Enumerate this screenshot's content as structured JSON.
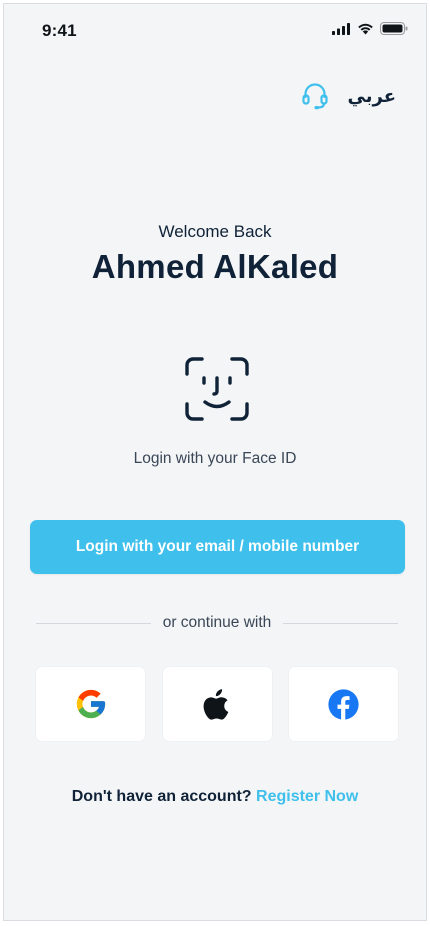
{
  "status_bar": {
    "time": "9:41"
  },
  "header": {
    "language_label": "عربي"
  },
  "greeting": {
    "welcome": "Welcome Back",
    "name": "Ahmed AlKaled"
  },
  "face_id": {
    "label": "Login with your Face ID"
  },
  "primary_button": {
    "label": "Login with your email / mobile number"
  },
  "divider": {
    "text": "or continue with"
  },
  "social": [
    {
      "provider": "google",
      "icon": "google-icon"
    },
    {
      "provider": "apple",
      "icon": "apple-icon"
    },
    {
      "provider": "facebook",
      "icon": "facebook-icon"
    }
  ],
  "register": {
    "prompt": "Don't have an account?",
    "link": "Register Now"
  },
  "colors": {
    "accent": "#3fc0ec",
    "text": "#0f2237",
    "background": "#f4f5f7",
    "facebook": "#1877f2"
  }
}
